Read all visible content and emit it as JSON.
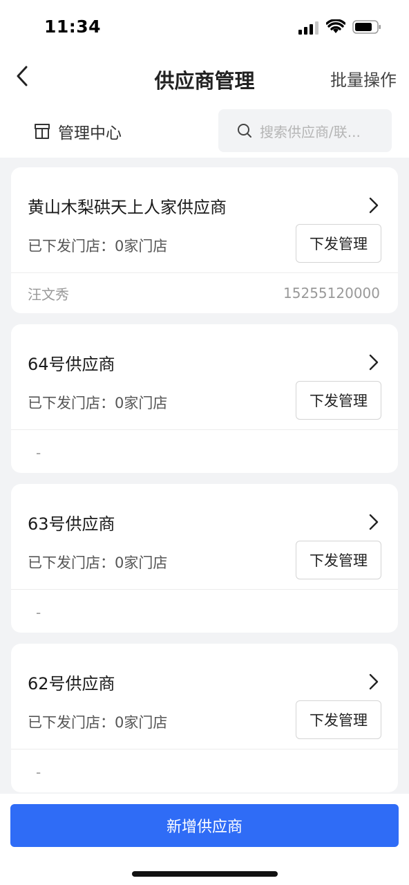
{
  "status_bar": {
    "time": "11:34"
  },
  "nav": {
    "title": "供应商管理",
    "batch_label": "批量操作"
  },
  "center": {
    "label": "管理中心"
  },
  "search": {
    "placeholder": "搜索供应商/联..."
  },
  "suppliers": [
    {
      "name": "黄山木梨硔天上人家供应商",
      "stores": "已下发门店：0家门店",
      "button": "下发管理",
      "contact": "汪文秀",
      "phone": "15255120000"
    },
    {
      "name": "64号供应商",
      "stores": "已下发门店：0家门店",
      "button": "下发管理",
      "contact": "-",
      "phone": ""
    },
    {
      "name": "63号供应商",
      "stores": "已下发门店：0家门店",
      "button": "下发管理",
      "contact": "-",
      "phone": ""
    },
    {
      "name": "62号供应商",
      "stores": "已下发门店：0家门店",
      "button": "下发管理",
      "contact": "-",
      "phone": ""
    }
  ],
  "bottom": {
    "add_label": "新增供应商"
  },
  "colors": {
    "primary": "#2f6cf6",
    "background": "#f2f3f5"
  }
}
